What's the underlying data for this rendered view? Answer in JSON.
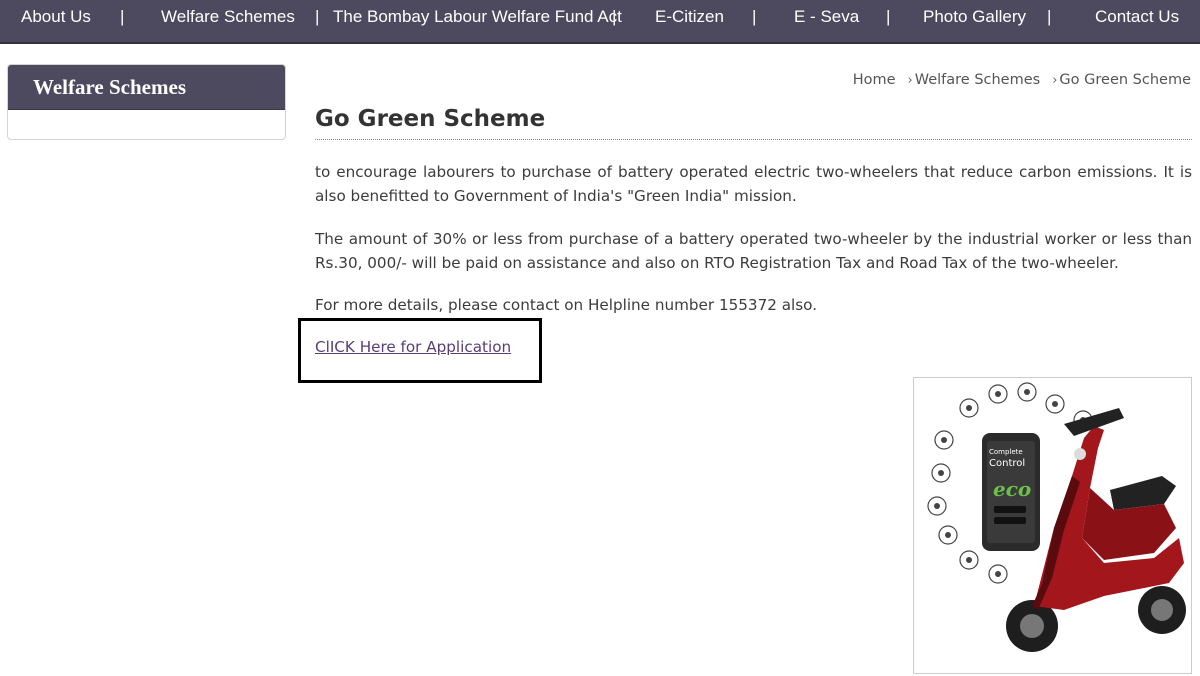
{
  "nav": {
    "items": [
      "About Us",
      "Welfare Schemes",
      "The Bombay Labour Welfare Fund Act",
      "E-Citizen",
      "E - Seva",
      "Photo Gallery",
      "Contact Us"
    ],
    "separator": "|"
  },
  "sidebar": {
    "title": "Welfare Schemes"
  },
  "breadcrumb": {
    "items": [
      "Home",
      "Welfare Schemes",
      "Go Green Scheme"
    ],
    "arrow": "›"
  },
  "main": {
    "title": "Go Green Scheme",
    "paragraphs": [
      "to encourage labourers to purchase of battery operated electric two-wheelers that reduce carbon emissions. It is also benefitted to Government of India's \"Green India\" mission.",
      "The amount of 30% or less from purchase of a battery operated two-wheeler by the industrial worker or less than Rs.30, 000/- will be paid on assistance and also on RTO Registration Tax and Road Tax of the two-wheeler.",
      "For more details, please contact on Helpline number 155372 also."
    ],
    "application_link": "ClICK Here for Application"
  },
  "product_image": {
    "phone_text": [
      "Complete",
      "Control",
      "eco"
    ],
    "colors": {
      "scooter": "#a3171c",
      "phone": "#2b2b2b",
      "eco_green": "#6cc04a"
    }
  },
  "colors": {
    "nav_bg": "#4d4a5f",
    "link": "#5b3d73"
  }
}
